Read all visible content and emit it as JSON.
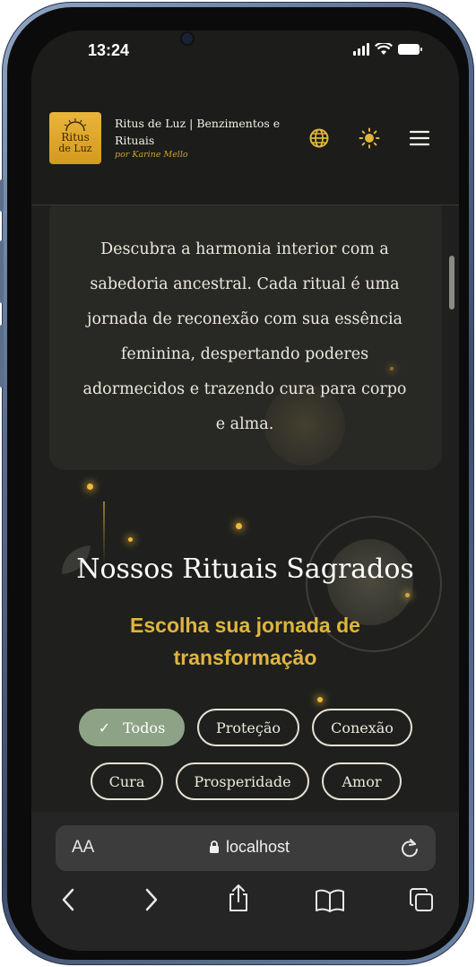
{
  "status_bar": {
    "time": "13:24"
  },
  "header": {
    "logo_line1": "Ritus",
    "logo_line2": "de Luz",
    "title": "Ritus de Luz | Benzimentos e Rituais",
    "subtitle": "por Karine Mello",
    "icons": [
      "globe-icon",
      "sun-icon",
      "menu-icon"
    ]
  },
  "intro": {
    "text": "Descubra a harmonia interior com a sabedoria ancestral. Cada ritual é uma jornada de reconexão com sua essência feminina, despertando poderes adormecidos e trazendo cura para corpo e alma."
  },
  "rituals": {
    "title": "Nossos Rituais Sagrados",
    "subtitle": "Escolha sua jornada de transformação",
    "filters": [
      "Todos",
      "Proteção",
      "Conexão",
      "Cura",
      "Prosperidade",
      "Amor"
    ],
    "active_filter": "Todos"
  },
  "browser": {
    "text_size_label": "AA",
    "url": "localhost"
  },
  "colors": {
    "accent_gold": "#e0b43e",
    "active_chip": "#8ea386",
    "background": "#1f201d"
  }
}
